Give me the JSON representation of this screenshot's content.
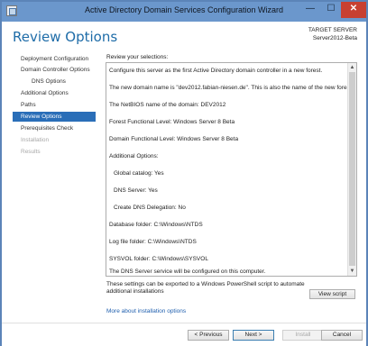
{
  "window": {
    "title": "Active Directory Domain Services Configuration Wizard",
    "minimize": "—",
    "maximize": "☐",
    "close": "✕"
  },
  "header": {
    "heading": "Review Options",
    "target_label": "TARGET SERVER",
    "target_name": "Server2012-Beta"
  },
  "nav": {
    "items": [
      {
        "label": "Deployment Configuration"
      },
      {
        "label": "Domain Controller Options"
      },
      {
        "label": "DNS Options"
      },
      {
        "label": "Additional Options"
      },
      {
        "label": "Paths"
      },
      {
        "label": "Review Options"
      },
      {
        "label": "Prerequisites Check"
      },
      {
        "label": "Installation"
      },
      {
        "label": "Results"
      }
    ]
  },
  "review": {
    "label": "Review your selections:",
    "lines": [
      "Configure this server as the first Active Directory domain controller in a new forest.",
      "The new domain name is \"dev2012.fabian-niesen.de\". This is also the name of the new forest.",
      "The NetBIOS name of the domain: DEV2012",
      "Forest Functional Level: Windows Server 8 Beta",
      "Domain Functional Level: Windows Server 8 Beta",
      "Additional Options:",
      "Global catalog: Yes",
      "DNS Server: Yes",
      "Create DNS Delegation: No",
      "Database folder: C:\\Windows\\NTDS",
      "Log file folder: C:\\Windows\\NTDS",
      "SYSVOL folder: C:\\Windows\\SYSVOL",
      "The DNS Server service will be configured on this computer.",
      "This computer will be configured to use this DNS server as its preferred DNS server."
    ]
  },
  "export": {
    "text": "These settings can be exported to a Windows PowerShell script to automate additional installations",
    "view_script": "View script",
    "more_link": "More about installation options"
  },
  "footer": {
    "previous": "< Previous",
    "next": "Next >",
    "install": "Install",
    "cancel": "Cancel"
  }
}
